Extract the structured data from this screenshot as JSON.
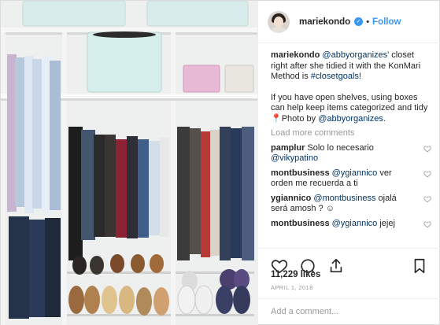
{
  "post": {
    "username": "mariekondo",
    "verified_icon": "verified-check-icon",
    "separator": "•",
    "follow_label": "Follow",
    "caption": {
      "username": "mariekondo",
      "mention": "@abbyorganizes",
      "text1": "' closet right after she tidied it with the KonMari Method is ",
      "hashtag": "#closetgoals",
      "text2": "!",
      "text3": "If you have open shelves, using boxes can help keep items categorized and tidy ",
      "pin_icon": "pin-icon",
      "text4": "Photo by ",
      "photo_credit": "@abbyorganizes",
      "text5": "."
    },
    "load_more_label": "Load more comments",
    "comments": [
      {
        "user": "pamplur",
        "mention": "",
        "text": "Solo lo necesario ",
        "tail_mention": "@vikypatino"
      },
      {
        "user": "montbusiness",
        "mention": "@ygiannico",
        "text": " ver orden me recuerda a ti",
        "tail_mention": ""
      },
      {
        "user": "ygiannico",
        "mention": "@montbusiness",
        "text": " ojalá será amosh ?",
        "tail_mention": "",
        "emoji": "☺"
      },
      {
        "user": "montbusiness",
        "mention": "@ygiannico",
        "text": " jejej",
        "tail_mention": ""
      }
    ],
    "actions": [
      "heart-icon",
      "comment-icon",
      "share-icon",
      "bookmark-icon"
    ],
    "likes": "11,229 likes",
    "date": "APRIL 1, 2018",
    "add_comment_placeholder": "Add a comment..."
  },
  "colors": {
    "link": "#003569",
    "follow": "#3897f0",
    "muted": "#999999"
  }
}
